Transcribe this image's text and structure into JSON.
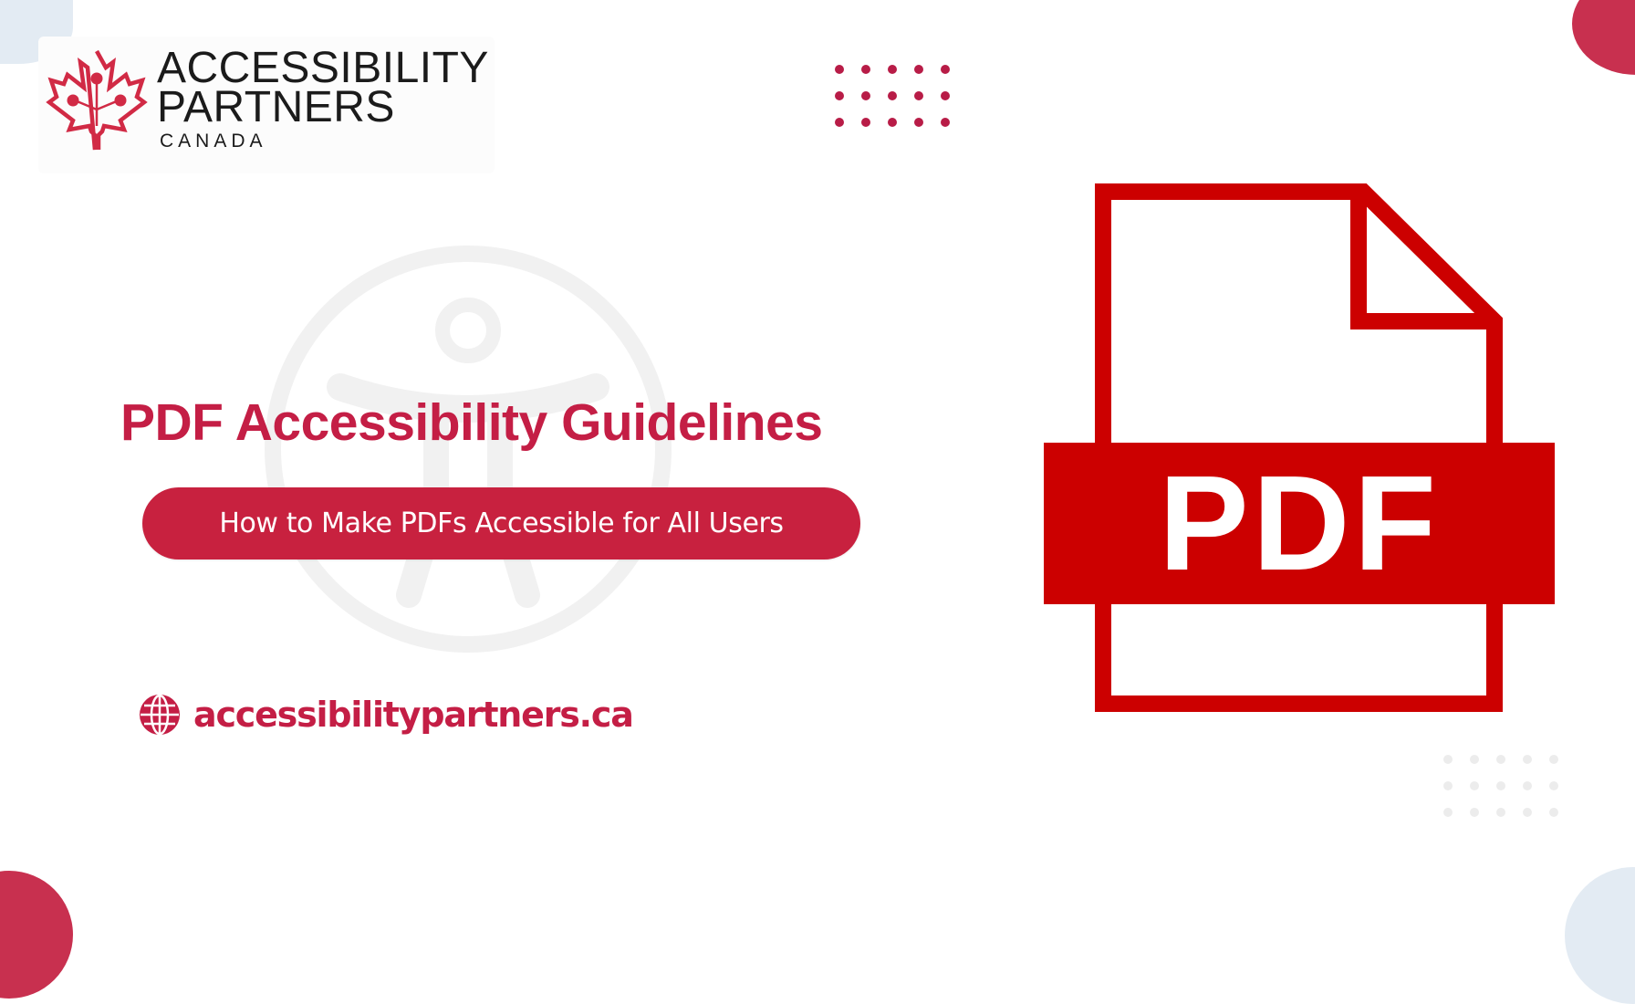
{
  "brand": {
    "name_line1": "ACCESSIBILITY",
    "name_line2": "PARTNERS",
    "name_line3": "CANADA",
    "logo_icon": "maple-leaf-circuit-icon"
  },
  "hero": {
    "title": "PDF Accessibility Guidelines",
    "subtitle": "How to Make PDFs Accessible for All Users",
    "watermark_icon": "universal-access-icon"
  },
  "website": {
    "icon": "globe-icon",
    "url": "accessibilitypartners.ca"
  },
  "pdf_graphic": {
    "icon": "pdf-file-icon",
    "label": "PDF"
  },
  "colors": {
    "brand_red": "#c41e45",
    "pill_red": "#c8213f",
    "pdf_red": "#cc0000",
    "accent_blue": "#e3ebf3",
    "text_dark": "#1b1b1b"
  }
}
